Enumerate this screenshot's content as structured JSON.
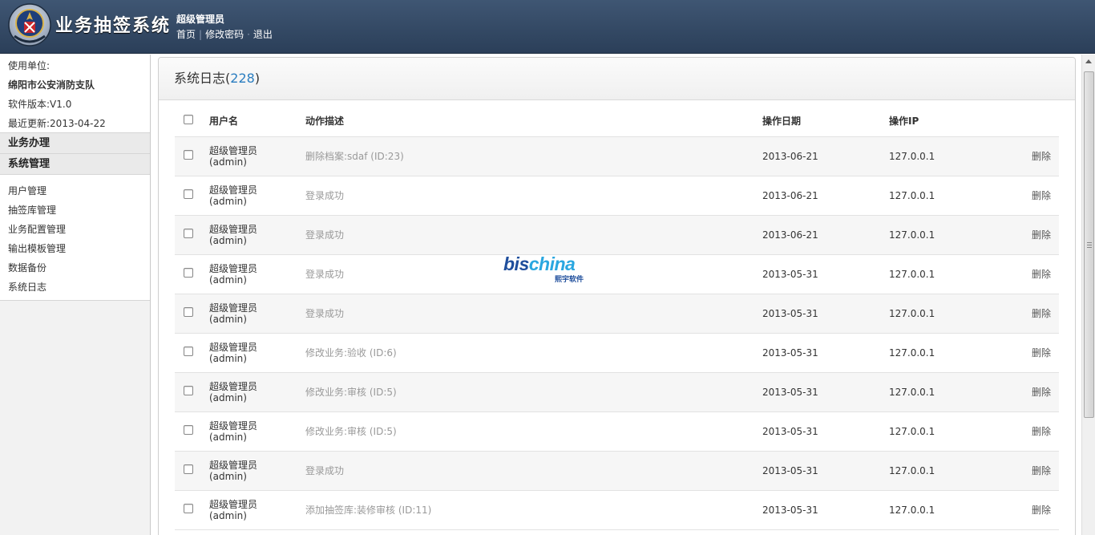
{
  "header": {
    "app_title": "业务抽签系统",
    "user_name": "超级管理员",
    "links": [
      "首页",
      "修改密码",
      "退出"
    ]
  },
  "sidebar": {
    "info": {
      "unit_label": "使用单位:",
      "unit_name": "绵阳市公安消防支队",
      "version": "软件版本:V1.0",
      "updated": "最近更新:2013-04-22"
    },
    "sections": [
      "业务办理",
      "系统管理"
    ],
    "items": [
      "用户管理",
      "抽签库管理",
      "业务配置管理",
      "输出模板管理",
      "数据备份",
      "系统日志"
    ]
  },
  "panel": {
    "title": "系统日志",
    "count": "228"
  },
  "table": {
    "headers": [
      "用户名",
      "动作描述",
      "操作日期",
      "操作IP"
    ],
    "rows": [
      {
        "user": "超级管理员",
        "account": "(admin)",
        "action": "删除档案:sdaf (ID:23)",
        "date": "2013-06-21",
        "ip": "127.0.0.1",
        "op": "删除"
      },
      {
        "user": "超级管理员",
        "account": "(admin)",
        "action": "登录成功",
        "date": "2013-06-21",
        "ip": "127.0.0.1",
        "op": "删除"
      },
      {
        "user": "超级管理员",
        "account": "(admin)",
        "action": "登录成功",
        "date": "2013-06-21",
        "ip": "127.0.0.1",
        "op": "删除"
      },
      {
        "user": "超级管理员",
        "account": "(admin)",
        "action": "登录成功",
        "date": "2013-05-31",
        "ip": "127.0.0.1",
        "op": "删除"
      },
      {
        "user": "超级管理员",
        "account": "(admin)",
        "action": "登录成功",
        "date": "2013-05-31",
        "ip": "127.0.0.1",
        "op": "删除"
      },
      {
        "user": "超级管理员",
        "account": "(admin)",
        "action": "修改业务:验收 (ID:6)",
        "date": "2013-05-31",
        "ip": "127.0.0.1",
        "op": "删除"
      },
      {
        "user": "超级管理员",
        "account": "(admin)",
        "action": "修改业务:审核 (ID:5)",
        "date": "2013-05-31",
        "ip": "127.0.0.1",
        "op": "删除"
      },
      {
        "user": "超级管理员",
        "account": "(admin)",
        "action": "修改业务:审核 (ID:5)",
        "date": "2013-05-31",
        "ip": "127.0.0.1",
        "op": "删除"
      },
      {
        "user": "超级管理员",
        "account": "(admin)",
        "action": "登录成功",
        "date": "2013-05-31",
        "ip": "127.0.0.1",
        "op": "删除"
      },
      {
        "user": "超级管理员",
        "account": "(admin)",
        "action": "添加抽签库:装修审核 (ID:11)",
        "date": "2013-05-31",
        "ip": "127.0.0.1",
        "op": "删除"
      }
    ]
  },
  "watermark": {
    "brand_a": "bis",
    "brand_b": "china",
    "sub": "熙宇软件"
  },
  "colors": {
    "header_bg": "#34495f",
    "count_blue": "#2a7dc0"
  },
  "icons": [
    "fire-badge-logo",
    "checkbox-icon",
    "scroll-up-arrow-icon"
  ]
}
